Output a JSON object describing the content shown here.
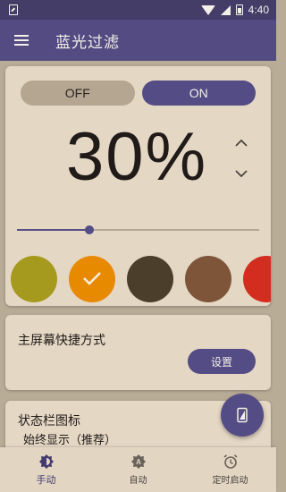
{
  "status_bar": {
    "time": "4:40"
  },
  "app_bar": {
    "title": "蓝光过滤"
  },
  "filter": {
    "off_label": "OFF",
    "on_label": "ON",
    "state": "on",
    "intensity_text": "30%",
    "intensity_value": 0.3
  },
  "swatches": [
    {
      "color": "#a59a1e",
      "selected": false
    },
    {
      "color": "#e88a00",
      "selected": true
    },
    {
      "color": "#4b3f2c",
      "selected": false
    },
    {
      "color": "#7e5539",
      "selected": false
    },
    {
      "color": "#d22d1f",
      "selected": false
    }
  ],
  "shortcut": {
    "title": "主屏幕快捷方式",
    "button_label": "设置"
  },
  "status_icon": {
    "title": "状态栏图标",
    "value": "始终显示（推荐）"
  },
  "bottom_nav": {
    "items": [
      {
        "label": "手动",
        "icon": "brightness-icon",
        "active": true
      },
      {
        "label": "自动",
        "icon": "auto-brightness-icon",
        "active": false
      },
      {
        "label": "定时启动",
        "icon": "alarm-clock-icon",
        "active": false
      }
    ]
  },
  "colors": {
    "primary": "#534b82",
    "status_bar": "#433d68",
    "card": "#e4d7c4",
    "background": "#b9ac97"
  }
}
